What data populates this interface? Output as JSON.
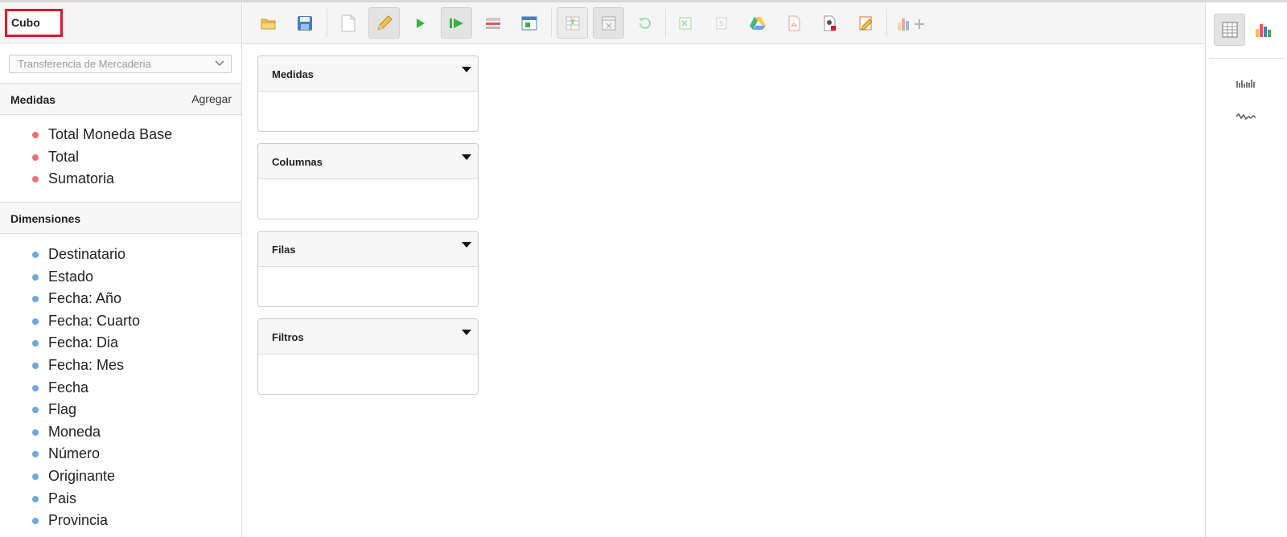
{
  "sidebar": {
    "cube_label": "Cubo",
    "cube_select": "Transferencia de Mercaderia",
    "measures_title": "Medidas",
    "measures_action": "Agregar",
    "measures": [
      "Total Moneda Base",
      "Total",
      "Sumatoria"
    ],
    "dimensions_title": "Dimensiones",
    "dimensions": [
      "Destinatario",
      "Estado",
      "Fecha: Año",
      "Fecha: Cuarto",
      "Fecha: Dia",
      "Fecha: Mes",
      "Fecha",
      "Flag",
      "Moneda",
      "Número",
      "Originante",
      "Pais",
      "Provincia"
    ]
  },
  "panels": {
    "measures": "Medidas",
    "columns": "Columnas",
    "rows": "Filas",
    "filters": "Filtros"
  },
  "toolbar": {
    "buttons": [
      "open-icon",
      "save-icon",
      "new-query-icon",
      "edit-icon",
      "run-icon",
      "auto-run-icon",
      "toggle-fields-icon",
      "swap-axes-icon",
      "drillthrough-icon",
      "hide-parents-icon",
      "export-xls-icon",
      "export-csv-icon",
      "export-odf-icon",
      "google-drive-icon",
      "export-pdf-icon",
      "mdx-icon",
      "edit-mdx-icon",
      "add-chart-icon"
    ]
  },
  "rightbar": {
    "buttons": [
      "table-icon",
      "chart-icon",
      "bar-sparkline-icon",
      "line-sparkline-icon"
    ]
  },
  "colors": {
    "measure_dot": "#e57373",
    "dimension_dot": "#6fa8dc",
    "highlight": "#d9182a"
  }
}
